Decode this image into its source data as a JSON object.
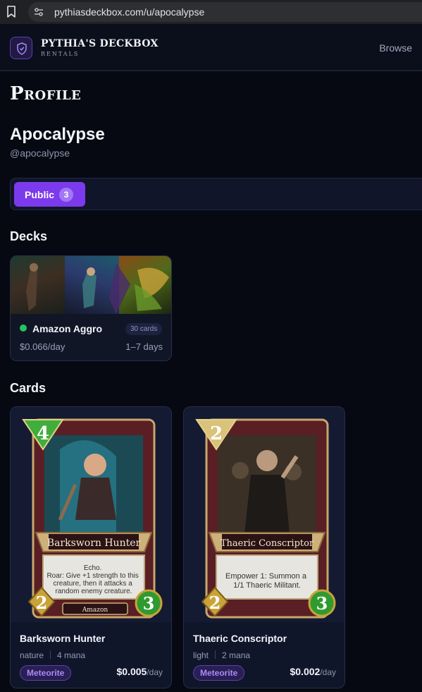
{
  "browser": {
    "url": "pythiasdeckbox.com/u/apocalypse"
  },
  "header": {
    "brand_title": "PYTHIA'S DECKBOX",
    "brand_subtitle": "RENTALS",
    "nav_browse": "Browse"
  },
  "page": {
    "heading": "Profile"
  },
  "user": {
    "name": "Apocalypse",
    "handle": "@apocalypse"
  },
  "tabs": {
    "public_label": "Public",
    "public_count": "3"
  },
  "decks": {
    "heading": "Decks",
    "items": [
      {
        "name": "Amazon Aggro",
        "card_count": "30 cards",
        "price": "$0.066/day",
        "duration": "1–7 days",
        "status_color": "#22c55e"
      }
    ]
  },
  "cards": {
    "heading": "Cards",
    "items": [
      {
        "name": "Barksworn Hunter",
        "element": "nature",
        "mana": "4 mana",
        "rarity_badge": "Meteorite",
        "price": "$0.005",
        "price_unit": "/day",
        "art": {
          "cost": "4",
          "banner": "Barksworn Hunter",
          "text": "Echo.\nRoar: Give +1 strength to this creature, then it attacks a random enemy creature.",
          "attack": "2",
          "health": "3",
          "tribe": "Amazon",
          "gem_color": "#3fae3a"
        }
      },
      {
        "name": "Thaeric Conscriptor",
        "element": "light",
        "mana": "2 mana",
        "rarity_badge": "Meteorite",
        "price": "$0.002",
        "price_unit": "/day",
        "art": {
          "cost": "2",
          "banner": "Thaeric Conscriptor",
          "text": "Empower 1: Summon a 1/1 Thaeric Militant.",
          "attack": "2",
          "health": "3",
          "tribe": "",
          "gem_color": "#d9c27a"
        }
      }
    ]
  },
  "colors": {
    "accent": "#7c3aed",
    "background": "#070912",
    "badge_text": "#a78bfa"
  }
}
